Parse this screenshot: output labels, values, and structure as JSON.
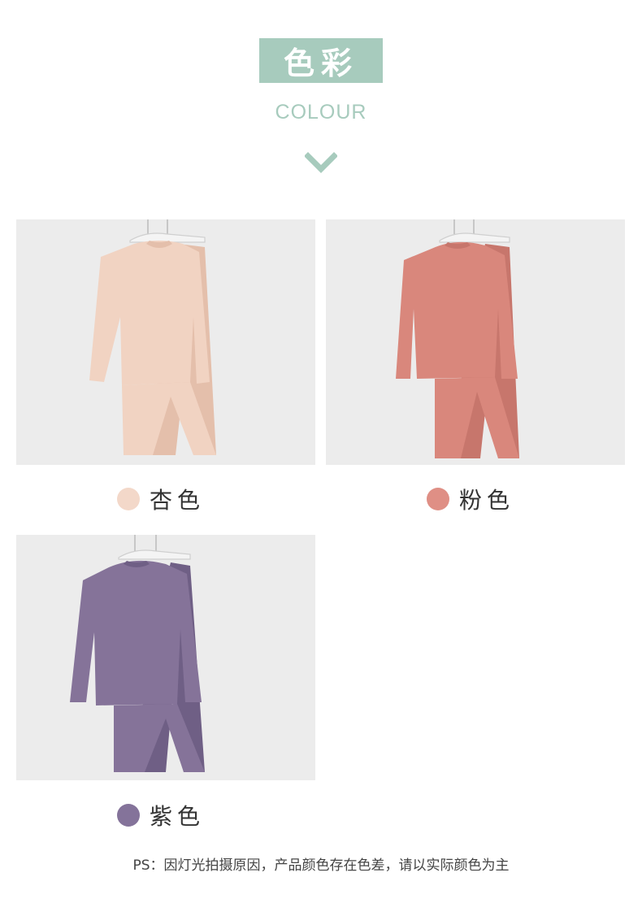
{
  "header": {
    "title": "色彩",
    "subtitle": "COLOUR",
    "accent_color": "#a7cbbd",
    "chevron_icon": "chevron-down-icon"
  },
  "colors": [
    {
      "name": "杏色",
      "dot_color": "#f3d8c9",
      "garment_color": "#f1d3c2",
      "garment_shade": "#e4bfab"
    },
    {
      "name": "粉色",
      "dot_color": "#df8f85",
      "garment_color": "#d9877c",
      "garment_shade": "#c7766c"
    },
    {
      "name": "紫色",
      "dot_color": "#84739a",
      "garment_color": "#857399",
      "garment_shade": "#6f5f85"
    }
  ],
  "footer": {
    "note": "PS：因灯光拍摄原因，产品颜色存在色差，请以实际颜色为主"
  }
}
